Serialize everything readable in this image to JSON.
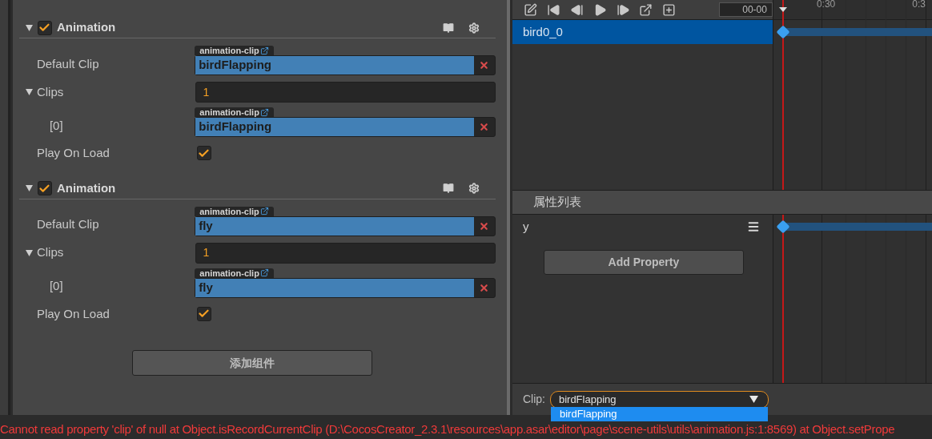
{
  "inspector": {
    "components": [
      {
        "title": "Animation",
        "enabled": true,
        "expanded": true,
        "default_clip": {
          "label": "Default Clip",
          "tag": "animation-clip",
          "value": "birdFlapping"
        },
        "clips": {
          "label": "Clips",
          "expanded": true,
          "count": "1",
          "items": [
            {
              "label": "[0]",
              "tag": "animation-clip",
              "value": "birdFlapping"
            }
          ]
        },
        "play_on_load": {
          "label": "Play On Load",
          "checked": true
        }
      },
      {
        "title": "Animation",
        "enabled": true,
        "expanded": true,
        "default_clip": {
          "label": "Default Clip",
          "tag": "animation-clip",
          "value": "fly"
        },
        "clips": {
          "label": "Clips",
          "expanded": true,
          "count": "1",
          "items": [
            {
              "label": "[0]",
              "tag": "animation-clip",
              "value": "fly"
            }
          ]
        },
        "play_on_load": {
          "label": "Play On Load",
          "checked": true
        }
      }
    ],
    "add_component_button": "添加组件"
  },
  "timeline": {
    "time_field": "00-00",
    "ruler_labels": [
      "0:30",
      "0:3"
    ],
    "nodes": [
      {
        "name": "bird0_0",
        "selected": true
      }
    ],
    "section_title": "属性列表",
    "properties": [
      {
        "name": "y"
      }
    ],
    "add_property_button": "Add Property",
    "clip_label": "Clip:",
    "clip_value": "birdFlapping",
    "dropdown_options": [
      {
        "label": "birdFlapping",
        "selected": true
      }
    ]
  },
  "error_message": "Cannot read property 'clip' of null at Object.isRecordCurrentClip (D:\\CocosCreator_2.3.1\\resources\\app.asar\\editor\\page\\scene-utils\\utils\\animation.js:1:8569) at Object.setPrope"
}
